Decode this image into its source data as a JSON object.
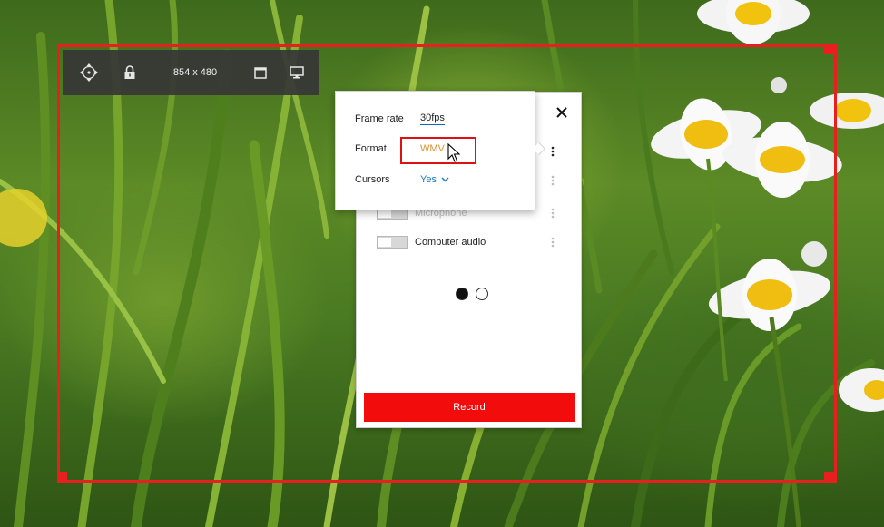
{
  "toolbar": {
    "size_label": "854 x 480",
    "icons": [
      "move-icon",
      "lock-icon",
      "window-icon",
      "monitor-icon"
    ]
  },
  "recorder": {
    "rows": [
      {
        "label": "Microphone",
        "enabled": false
      },
      {
        "label": "Computer audio",
        "enabled": false
      }
    ],
    "page_dots": {
      "count": 2,
      "active": 1
    },
    "record_label": "Record"
  },
  "settings_popup": {
    "frame_rate_label": "Frame rate",
    "frame_rate_value": "30fps",
    "format_label": "Format",
    "format_value": "WMV",
    "cursors_label": "Cursors",
    "cursors_value": "Yes"
  },
  "colors": {
    "selection": "#e81f1f",
    "record_button": "#f30c0c",
    "format_value": "#e09433",
    "cursors_value": "#1e7bc8"
  }
}
